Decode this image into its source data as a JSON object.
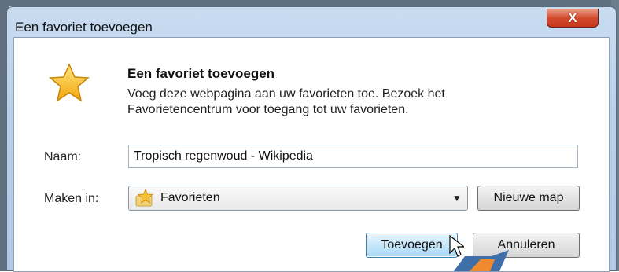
{
  "dialog": {
    "title": "Een favoriet toevoegen",
    "close_label": "X"
  },
  "header": {
    "title": "Een favoriet toevoegen",
    "description": "Voeg deze webpagina aan uw favorieten toe. Bezoek het Favorietencentrum voor toegang tot uw favorieten."
  },
  "form": {
    "name_label": "Naam:",
    "name_value": "Tropisch regenwoud - Wikipedia",
    "create_in_label": "Maken in:",
    "folder_value": "Favorieten",
    "new_folder_label": "Nieuwe map"
  },
  "buttons": {
    "add_label": "Toevoegen",
    "cancel_label": "Annuleren"
  },
  "colors": {
    "title_bar": "#b9d0ea",
    "close_button": "#d24a2c",
    "default_button": "#a7d9f5",
    "star": "#f6c23a"
  },
  "icons": {
    "favorite_star": "star-icon",
    "folder_star": "favorites-folder-icon",
    "dropdown": "chevron-down-icon"
  }
}
